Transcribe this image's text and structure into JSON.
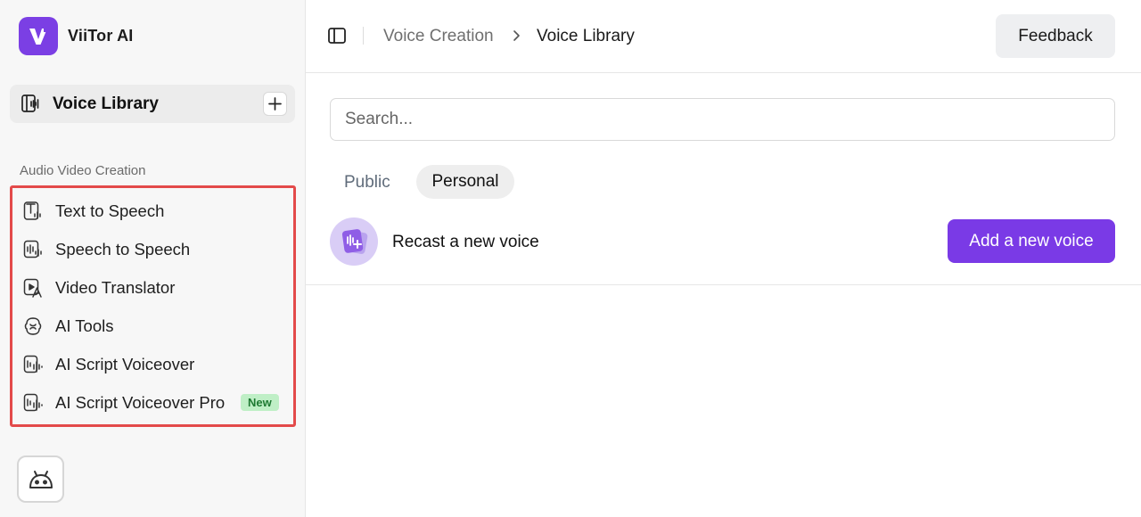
{
  "app": {
    "name": "ViiTor AI",
    "logo_letter": "V",
    "brand_color": "#7b3fe4"
  },
  "sidebar": {
    "library_item": {
      "label": "Voice Library",
      "icon": "voice-library-icon"
    },
    "section_title": "Audio Video Creation",
    "items": [
      {
        "label": "Text to Speech",
        "icon": "text-to-speech-icon"
      },
      {
        "label": "Speech to Speech",
        "icon": "speech-to-speech-icon"
      },
      {
        "label": "Video Translator",
        "icon": "video-translator-icon"
      },
      {
        "label": "AI Tools",
        "icon": "ai-tools-icon"
      },
      {
        "label": "AI Script Voiceover",
        "icon": "script-voiceover-icon"
      },
      {
        "label": "AI Script Voiceover Pro",
        "icon": "script-voiceover-pro-icon",
        "badge": "New"
      }
    ],
    "highlight_color": "#e34a4a"
  },
  "header": {
    "breadcrumb": [
      "Voice Creation",
      "Voice Library"
    ],
    "feedback_label": "Feedback"
  },
  "main": {
    "search": {
      "placeholder": "Search...",
      "value": ""
    },
    "tabs": [
      {
        "label": "Public",
        "active": false
      },
      {
        "label": "Personal",
        "active": true
      }
    ],
    "recast": {
      "label": "Recast a new voice",
      "button_label": "Add a new voice",
      "button_color": "#7a3ae6"
    }
  }
}
